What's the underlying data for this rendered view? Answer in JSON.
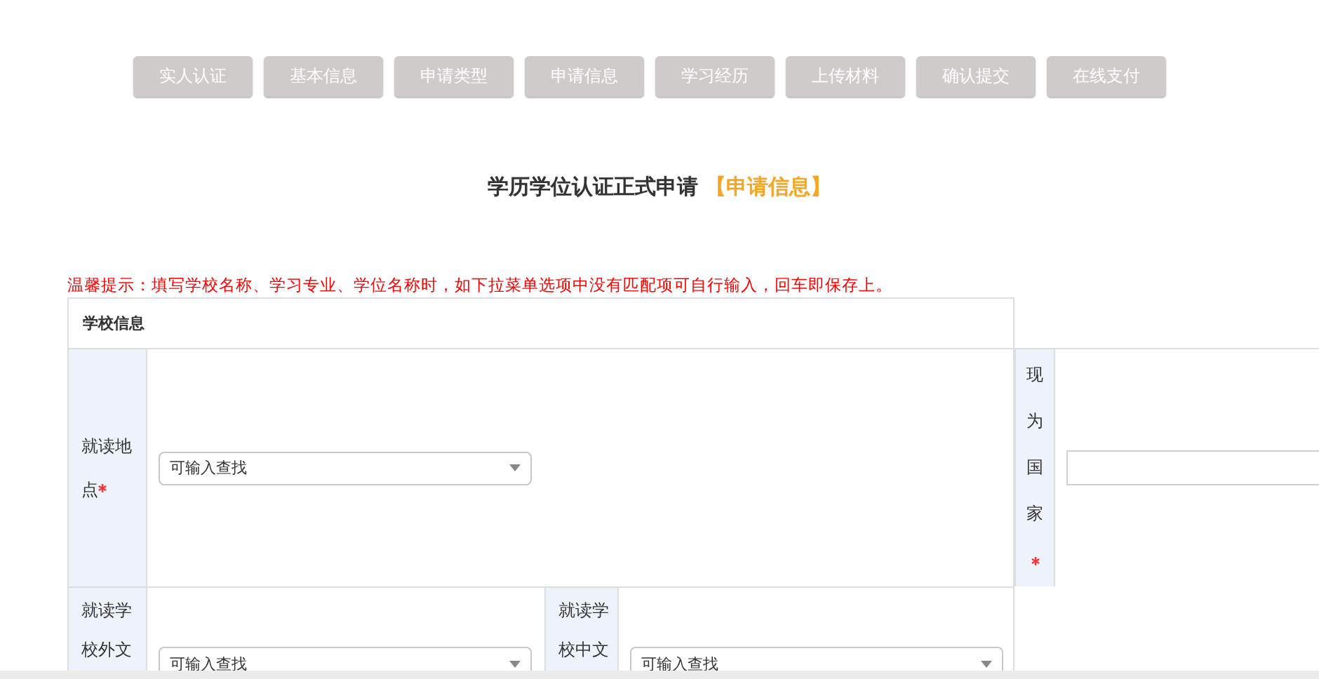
{
  "steps": [
    {
      "label": "实人认证"
    },
    {
      "label": "基本信息"
    },
    {
      "label": "申请类型"
    },
    {
      "label": "申请信息"
    },
    {
      "label": "学习经历"
    },
    {
      "label": "上传材料"
    },
    {
      "label": "确认提交"
    },
    {
      "label": "在线支付"
    }
  ],
  "title": {
    "text": "学历学位认证正式申请",
    "step": "【申请信息】"
  },
  "notice": "温馨提示：填写学校名称、学习专业、学位名称时，如下拉菜单选项中没有匹配项可自行输入，回车即保存上。",
  "section": {
    "title": "学校信息",
    "fields": [
      {
        "label": "就读地点",
        "required": true,
        "kind": "select",
        "placeholder": "可输入查找"
      },
      {
        "label": "现为国家",
        "required": true,
        "kind": "text"
      },
      {
        "label": "就读学校外文",
        "kind": "select",
        "placeholder": "可输入查找"
      },
      {
        "label": "就读学校中文",
        "kind": "select",
        "placeholder": "可输入查找"
      }
    ]
  }
}
